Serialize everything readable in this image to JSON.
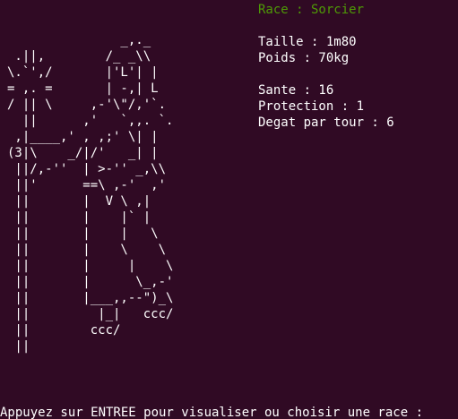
{
  "race": {
    "label": "Race : Sorcier",
    "color": "#4e9a06"
  },
  "stats": {
    "taille": "Taille : 1m80",
    "poids": "Poids : 70kg",
    "sante": "Sante : 16",
    "protection": "Protection : 1",
    "degat": "Degat par tour : 6"
  },
  "ascii_art": "               _,._\n .||,        /_ _\\\\\n\\.`',/       |'L'| |\n= ,. =       | -,| L\n/ || \\     ,-'\\\"/,'`.\n  ||      ,'   `,,. `.\n ,|____,' , ,;' \\| |\n(3|\\    _/|/'   _| |\n ||/,-''  | >-'' _,\\\\\n ||'      ==\\ ,-'  ,'\n ||       |  V \\ ,|\n ||       |    |` |\n ||       |    |   \\\n ||       |    \\    \\\n ||       |     |    \\\n ||       |      \\_,-'\n ||       |___,,--\")_\\\n ||         |_|   ccc/\n ||        ccc/\n ||",
  "prompt": "Appuyez sur ENTREE pour visualiser ou choisir une race : ",
  "theme": {
    "background": "#300a24",
    "foreground": "#ffffff"
  }
}
